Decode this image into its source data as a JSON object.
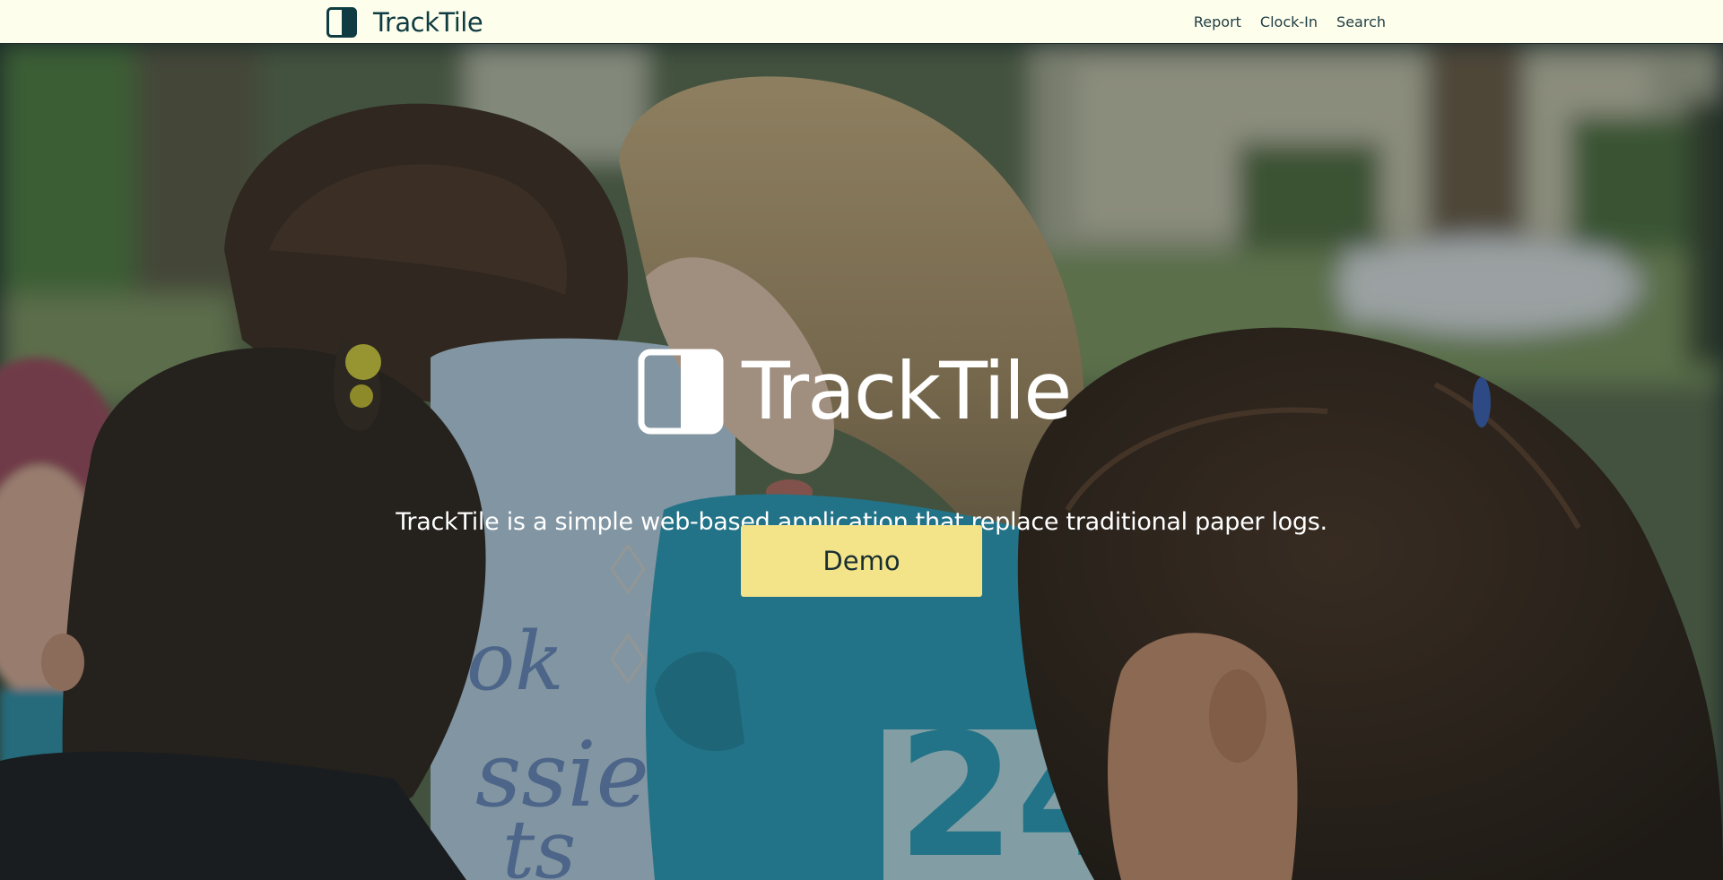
{
  "navbar": {
    "brand": "TrackTile",
    "links": [
      "Report",
      "Clock-In",
      "Search"
    ]
  },
  "hero": {
    "title": "TrackTile",
    "tagline": "TrackTile is a simple web-based application that replace traditional paper logs.",
    "button_label": "Demo",
    "background_image": "photo of volunteers in blue 24 Hours shirts gathered together outdoors",
    "shirt_print": "24"
  },
  "icons": {
    "brand_logo": "half-filled-square-icon",
    "hero_logo": "half-filled-square-icon"
  },
  "colors": {
    "navbar_bg": "#fefeec",
    "brand_text": "#0f3c42",
    "nav_link": "#1f3d44",
    "accent_button": "#f3e48a",
    "button_text": "#1a2f31",
    "hero_text": "#ffffff"
  }
}
